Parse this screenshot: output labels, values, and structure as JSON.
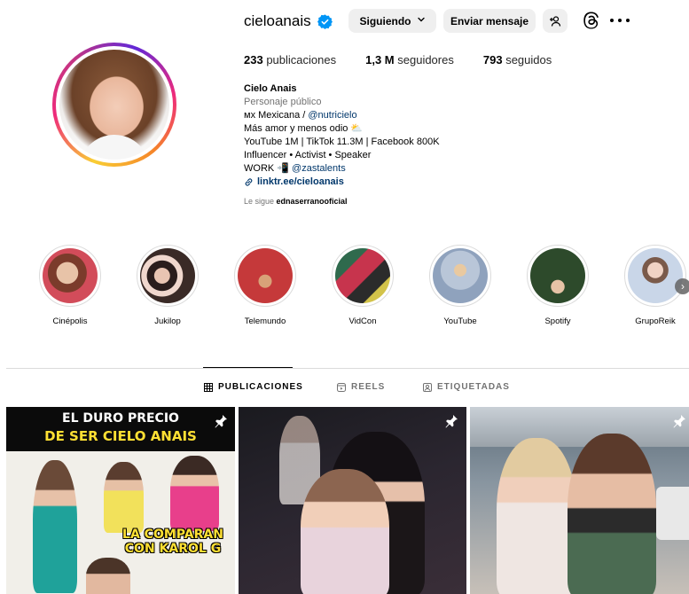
{
  "profile": {
    "username": "cieloanais",
    "following_button": "Siguiendo",
    "message_button": "Enviar mensaje",
    "suggest_button": "+ᴿ",
    "stats": {
      "posts_count": "233",
      "posts_label": "publicaciones",
      "followers_count": "1,3 M",
      "followers_label": "seguidores",
      "following_count": "793",
      "following_label": "seguidos"
    },
    "bio": {
      "name": "Cielo Anais",
      "category": "Personaje público",
      "line1_prefix": "ᴍx Mexicana / ",
      "line1_mention": "@nutricielo",
      "line2": "Más amor y menos odio ⛅",
      "line3": "YouTube 1M | TikTok 11.3M | Facebook 800K",
      "line4": "Influencer • Activist • Speaker",
      "line5_prefix": "WORK 📲 ",
      "line5_mention": "@zastalents",
      "link": "linktr.ee/cieloanais"
    },
    "followed_by_prefix": "Le sigue ",
    "followed_by_user": "ednaserranooficial"
  },
  "highlights": [
    {
      "label": "Cinépolis",
      "color": "#c9a38a"
    },
    {
      "label": "Jukilop",
      "color": "#6d5650"
    },
    {
      "label": "Telemundo",
      "color": "#b83a2f"
    },
    {
      "label": "VidCon",
      "color": "#3e6b54"
    },
    {
      "label": "YouTube",
      "color": "#a8b7c9"
    },
    {
      "label": "Spotify",
      "color": "#3d5e3a"
    },
    {
      "label": "GrupoReik",
      "color": "#d9c7c3"
    }
  ],
  "tabs": {
    "posts": "PUBLICACIONES",
    "reels": "REELS",
    "tagged": "ETIQUETADAS"
  },
  "posts": {
    "post1_line1": "EL DURO PRECIO",
    "post1_line2": "DE SER CIELO ANAIS",
    "post1_line3": "LA COMPARAN CON KAROL G"
  },
  "colors": {
    "verified": "#0095f6",
    "button_bg": "#efefef",
    "link": "#00376b",
    "muted": "#737373"
  }
}
